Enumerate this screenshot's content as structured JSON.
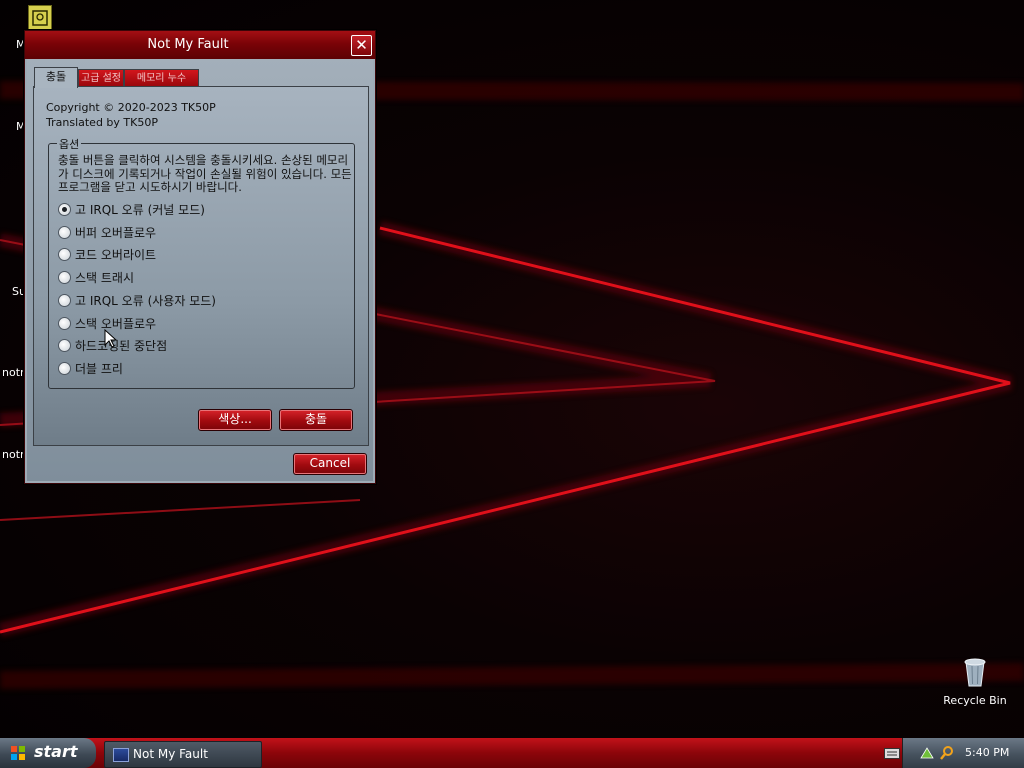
{
  "window": {
    "title": "Not My Fault",
    "close_glyph": "✕",
    "tabs": [
      {
        "label": "충돌",
        "active": true
      },
      {
        "label": "고급 설정",
        "active": false
      },
      {
        "label": "메모리 누수",
        "active": false
      }
    ],
    "copyright": "Copyright © 2020-2023 TK50P",
    "translated_by": "Translated by TK50P",
    "options_group": {
      "legend": "옵션",
      "description": "충돌 버튼을 클릭하여 시스템을 충돌시키세요. 손상된 메모리가 디스크에 기록되거나 작업이 손실될 위험이 있습니다. 모든 프로그램을 닫고 시도하시기 바랍니다.",
      "options": [
        {
          "label": "고 IRQL 오류 (커널 모드)",
          "checked": true
        },
        {
          "label": "버퍼 오버플로우",
          "checked": false
        },
        {
          "label": "코드 오버라이트",
          "checked": false
        },
        {
          "label": "스택 트래시",
          "checked": false
        },
        {
          "label": "고 IRQL 오류 (사용자 모드)",
          "checked": false
        },
        {
          "label": "스택 오버플로우",
          "checked": false
        },
        {
          "label": "하드코딩된 중단점",
          "checked": false
        },
        {
          "label": "더블 프리",
          "checked": false
        }
      ]
    },
    "color_button_label": "색상...",
    "crash_button_label": "충돌",
    "cancel_button_label": "Cancel"
  },
  "desktop": {
    "icons": [
      {
        "label": "Recycle Bin",
        "icon": "recycle-bin-icon"
      },
      {
        "label": "notepad-shortcut-icon",
        "icon": "notepad-icon"
      }
    ],
    "partial_labels": [
      "M",
      "M",
      "Su",
      "notr",
      "notr"
    ]
  },
  "taskbar": {
    "start_label": "start",
    "tasks": [
      {
        "label": "Not My Fault",
        "icon": "window-app-icon"
      }
    ],
    "clock": "5:40 PM"
  },
  "colors": {
    "accent": "#b00a10",
    "window_bg": "#9eabb6",
    "taskbar": "#8c050a"
  }
}
